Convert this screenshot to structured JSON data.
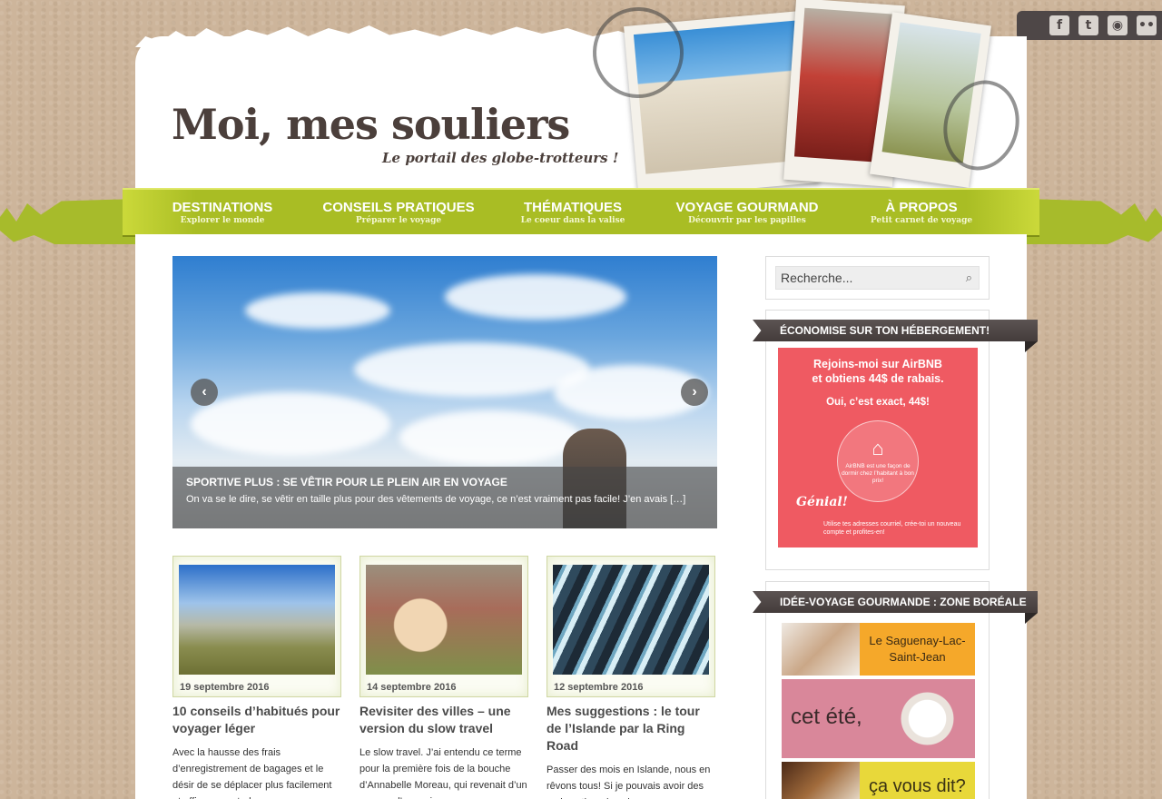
{
  "social": {
    "icons": [
      "facebook-icon",
      "twitter-icon",
      "rss-icon",
      "flickr-icon"
    ]
  },
  "header": {
    "title": "Moi, mes souliers",
    "tagline": "Le portail des globe-trotteurs !"
  },
  "nav": {
    "items": [
      {
        "label": "DESTINATIONS",
        "sub": "Explorer le monde"
      },
      {
        "label": "CONSEILS PRATIQUES",
        "sub": "Préparer le voyage"
      },
      {
        "label": "THÉMATIQUES",
        "sub": "Le coeur dans la valise"
      },
      {
        "label": "VOYAGE GOURMAND",
        "sub": "Découvrir par les papilles"
      },
      {
        "label": "À PROPOS",
        "sub": "Petit carnet de voyage"
      }
    ]
  },
  "slider": {
    "title": "SPORTIVE PLUS : SE VÊTIR POUR LE PLEIN AIR EN VOYAGE",
    "excerpt": "On va se le dire, se vêtir en taille plus pour des vêtements de voyage, ce n’est vraiment pas facile! J’en avais […]",
    "prev": "‹",
    "next": "›"
  },
  "posts": [
    {
      "date": "19 septembre 2016",
      "title": "10 conseils d’habitués pour voyager léger",
      "excerpt": "Avec la hausse des frais d’enregistrement de bagages et le désir de se déplacer plus facilement et efficacement, de"
    },
    {
      "date": "14 septembre 2016",
      "title": "Revisiter des villes – une version du slow travel",
      "excerpt": "Le slow travel. J’ai entendu ce terme pour la première fois de la bouche d’Annabelle Moreau, qui revenait d’un voyage d’un mois"
    },
    {
      "date": "12 septembre 2016",
      "title": "Mes suggestions : le tour de l’Islande par la Ring Road",
      "excerpt": "Passer des mois en Islande, nous en rêvons tous! Si je pouvais avoir des mois entiers dans les"
    }
  ],
  "sidebar": {
    "search_placeholder": "Recherche...",
    "widget1_title": "ÉCONOMISE SUR TON HÉBERGEMENT!",
    "widget2_title": "IDÉE-VOYAGE GOURMANDE : ZONE BORÉALE",
    "airbnb": {
      "line1": "Rejoins-moi sur AirBNB",
      "line2": "et obtiens 44$ de rabais.",
      "line3": "Oui, c’est exact, 44$!",
      "circle_text": "AirBNB est une façon de dormir chez l’habitant à bon prix!",
      "genial": "Génial!",
      "fine": "Utilise tes adresses courriel, crée-toi un nouveau compte et profites-en!"
    },
    "promo": {
      "p1": "Le Saguenay-Lac-Saint-Jean",
      "p2": "cet été,",
      "p3": "ça vous dit?"
    }
  },
  "colors": {
    "nav_green": "#a9bd24",
    "widget_title_bg": "#4e4645",
    "airbnb_pink": "#ef5a62"
  }
}
